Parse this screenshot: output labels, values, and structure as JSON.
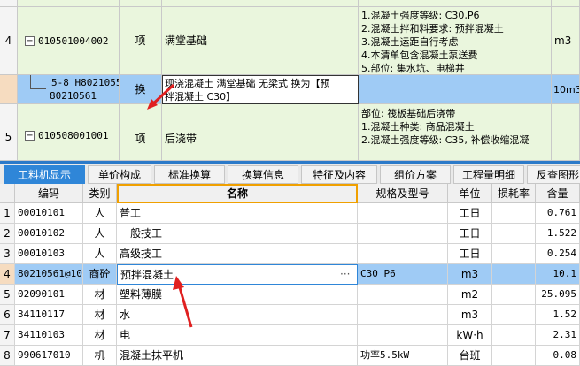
{
  "top_rows": [
    {
      "num": "",
      "code": "",
      "type": "",
      "name": "",
      "desc": "",
      "unit": ""
    },
    {
      "num": "4",
      "code": "010501004002",
      "type": "项",
      "name": "满堂基础",
      "desc": [
        "1.混凝土强度等级: C30,P6",
        "2.混凝土拌和料要求: 预拌混凝土",
        "3.混凝土运距自行考虑",
        "4.本清单包含混凝土泵送费",
        "5.部位: 集水坑、电梯井"
      ],
      "unit": "m3"
    },
    {
      "num": "",
      "code_line1": "5-8 H80210557",
      "code_line2": "80210561",
      "type": "换",
      "name_line1": "现浇混凝土 满堂基础 无梁式  换为【预",
      "name_line2": "拌混凝土 C30】",
      "unit": "10m3"
    },
    {
      "num": "5",
      "code": "010508001001",
      "type": "项",
      "name": "后浇带",
      "desc": [
        "部位: 筏板基础后浇带",
        "1.混凝土种类: 商品混凝土",
        "2.混凝土强度等级: C35, 补偿收缩混凝"
      ],
      "unit": ""
    }
  ],
  "tabs": [
    "工料机显示",
    "单价构成",
    "标准换算",
    "换算信息",
    "特征及内容",
    "组价方案",
    "工程量明细",
    "反查图形"
  ],
  "grid_headers": [
    "编码",
    "类别",
    "名称",
    "规格及型号",
    "单位",
    "损耗率",
    "含量"
  ],
  "grid_rows": [
    {
      "num": "1",
      "code": "00010101",
      "cat": "人",
      "name": "普工",
      "spec": "",
      "unit": "工日",
      "loss": "",
      "qty": "0.761"
    },
    {
      "num": "2",
      "code": "00010102",
      "cat": "人",
      "name": "一般技工",
      "spec": "",
      "unit": "工日",
      "loss": "",
      "qty": "1.522"
    },
    {
      "num": "3",
      "code": "00010103",
      "cat": "人",
      "name": "高级技工",
      "spec": "",
      "unit": "工日",
      "loss": "",
      "qty": "0.254"
    },
    {
      "num": "4",
      "code": "80210561@10",
      "cat": "商砼",
      "name": "预拌混凝土",
      "spec": "C30 P6",
      "unit": "m3",
      "loss": "",
      "qty": "10.1"
    },
    {
      "num": "5",
      "code": "02090101",
      "cat": "材",
      "name": "塑料薄膜",
      "spec": "",
      "unit": "m2",
      "loss": "",
      "qty": "25.095"
    },
    {
      "num": "6",
      "code": "34110117",
      "cat": "材",
      "name": "水",
      "spec": "",
      "unit": "m3",
      "loss": "",
      "qty": "1.52"
    },
    {
      "num": "7",
      "code": "34110103",
      "cat": "材",
      "name": "电",
      "spec": "",
      "unit": "kW·h",
      "loss": "",
      "qty": "2.31"
    },
    {
      "num": "8",
      "code": "990617010",
      "cat": "机",
      "name": "混凝土抹平机",
      "spec": "功率5.5kW",
      "unit": "台班",
      "loss": "",
      "qty": "0.08"
    }
  ],
  "ellipsis": "···",
  "colors": {
    "accent": "#2f86d8",
    "selected_row": "#9fcbf5",
    "green_row": "#eaf6dd",
    "arrow": "#e02020"
  }
}
